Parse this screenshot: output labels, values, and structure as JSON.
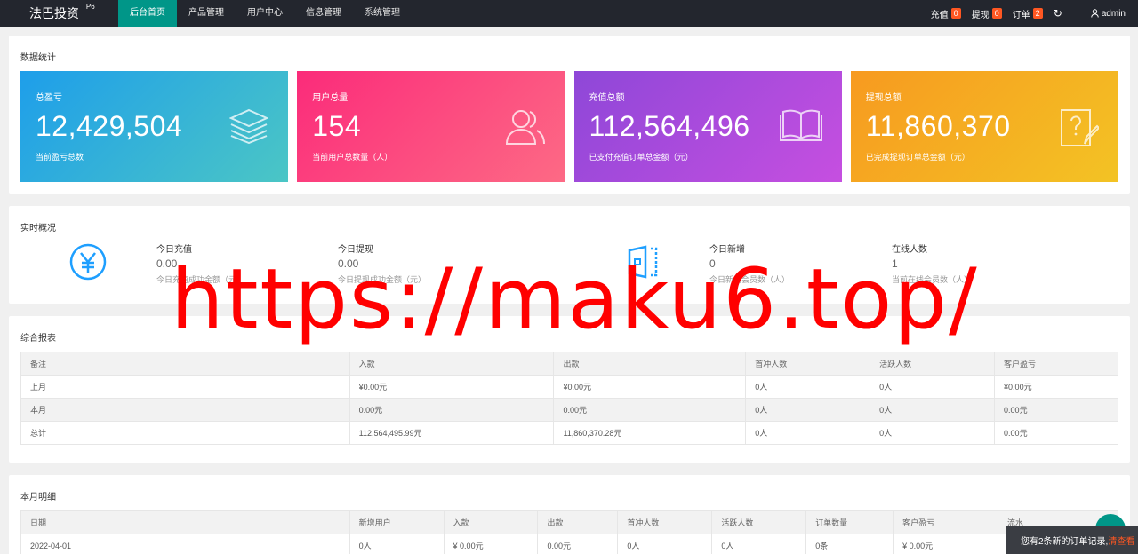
{
  "brand": {
    "name": "法巴投资",
    "tag": "TP6"
  },
  "nav": [
    "后台首页",
    "产品管理",
    "用户中心",
    "信息管理",
    "系统管理"
  ],
  "top_right": {
    "recharge": {
      "label": "充值",
      "count": "0"
    },
    "withdraw": {
      "label": "提现",
      "count": "0"
    },
    "order": {
      "label": "订单",
      "count": "2"
    },
    "user": "admin"
  },
  "stats": {
    "title": "数据统计",
    "cards": [
      {
        "label": "总盈亏",
        "value": "12,429,504",
        "desc": "当前盈亏总数",
        "icon": "layers-icon"
      },
      {
        "label": "用户总量",
        "value": "154",
        "desc": "当前用户总数量（人）",
        "icon": "users-icon"
      },
      {
        "label": "充值总额",
        "value": "112,564,496",
        "desc": "已支付充值订单总金额（元）",
        "icon": "book-icon"
      },
      {
        "label": "提现总额",
        "value": "11,860,370",
        "desc": "已完成提现订单总金额（元）",
        "icon": "question-edit-icon"
      }
    ]
  },
  "realtime": {
    "title": "实时概况",
    "items": [
      {
        "label": "今日充值",
        "value": "0.00",
        "desc": "今日充值成功金额（元）"
      },
      {
        "label": "今日提现",
        "value": "0.00",
        "desc": "今日提现成功金额（元）"
      },
      {
        "label": "今日新增",
        "value": "0",
        "desc": "今日新增会员数（人）"
      },
      {
        "label": "在线人数",
        "value": "1",
        "desc": "当前在线会员数（人）"
      }
    ]
  },
  "report": {
    "title": "综合报表",
    "headers": [
      "备注",
      "入款",
      "出款",
      "首冲人数",
      "活跃人数",
      "客户盈亏"
    ],
    "rows": [
      [
        "上月",
        "¥0.00元",
        "¥0.00元",
        "0人",
        "0人",
        "¥0.00元"
      ],
      [
        "本月",
        "0.00元",
        "0.00元",
        "0人",
        "0人",
        "0.00元"
      ],
      [
        "总计",
        "112,564,495.99元",
        "11,860,370.28元",
        "0人",
        "0人",
        "0.00元"
      ]
    ]
  },
  "monthly": {
    "title": "本月明细",
    "headers": [
      "日期",
      "新增用户",
      "入款",
      "出款",
      "首冲人数",
      "活跃人数",
      "订单数量",
      "客户盈亏",
      "流水"
    ],
    "rows": [
      [
        "2022-04-01",
        "0人",
        "¥ 0.00元",
        "0.00元",
        "0人",
        "0人",
        "0条",
        "¥ 0.00元",
        ""
      ]
    ]
  },
  "watermark": "https://maku6.top/",
  "notice": {
    "text": "您有2条新的订单记录,",
    "action": "清查看"
  }
}
